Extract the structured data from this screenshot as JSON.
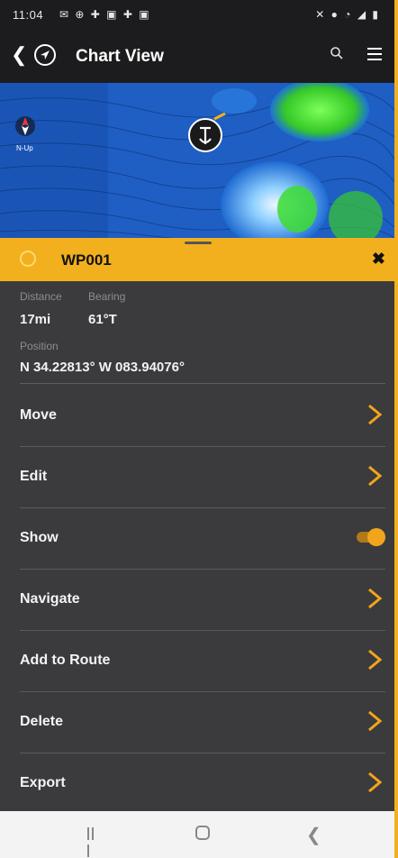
{
  "status_bar": {
    "time": "11:04",
    "left_icons": "✉ ⊕ ✚ ▣ ✚ ▣",
    "right_icons": "✕ ● ◔ ◢ ▮"
  },
  "header": {
    "title": "Chart View"
  },
  "map": {
    "north_label": "N-Up"
  },
  "waypoint": {
    "name": "WP001",
    "distance_label": "Distance",
    "distance_value": "17mi",
    "bearing_label": "Bearing",
    "bearing_value": "61°T",
    "position_label": "Position",
    "position_value": "N 34.22813° W 083.94076°"
  },
  "menu": {
    "items": [
      {
        "label": "Move"
      },
      {
        "label": "Edit"
      },
      {
        "label": "Show",
        "toggle_on": true
      },
      {
        "label": "Navigate"
      },
      {
        "label": "Add to Route"
      },
      {
        "label": "Delete"
      },
      {
        "label": "Export"
      }
    ]
  },
  "colors": {
    "accent": "#f2b01e",
    "panel": "#3b3b3d",
    "header": "#1c1c1e"
  }
}
